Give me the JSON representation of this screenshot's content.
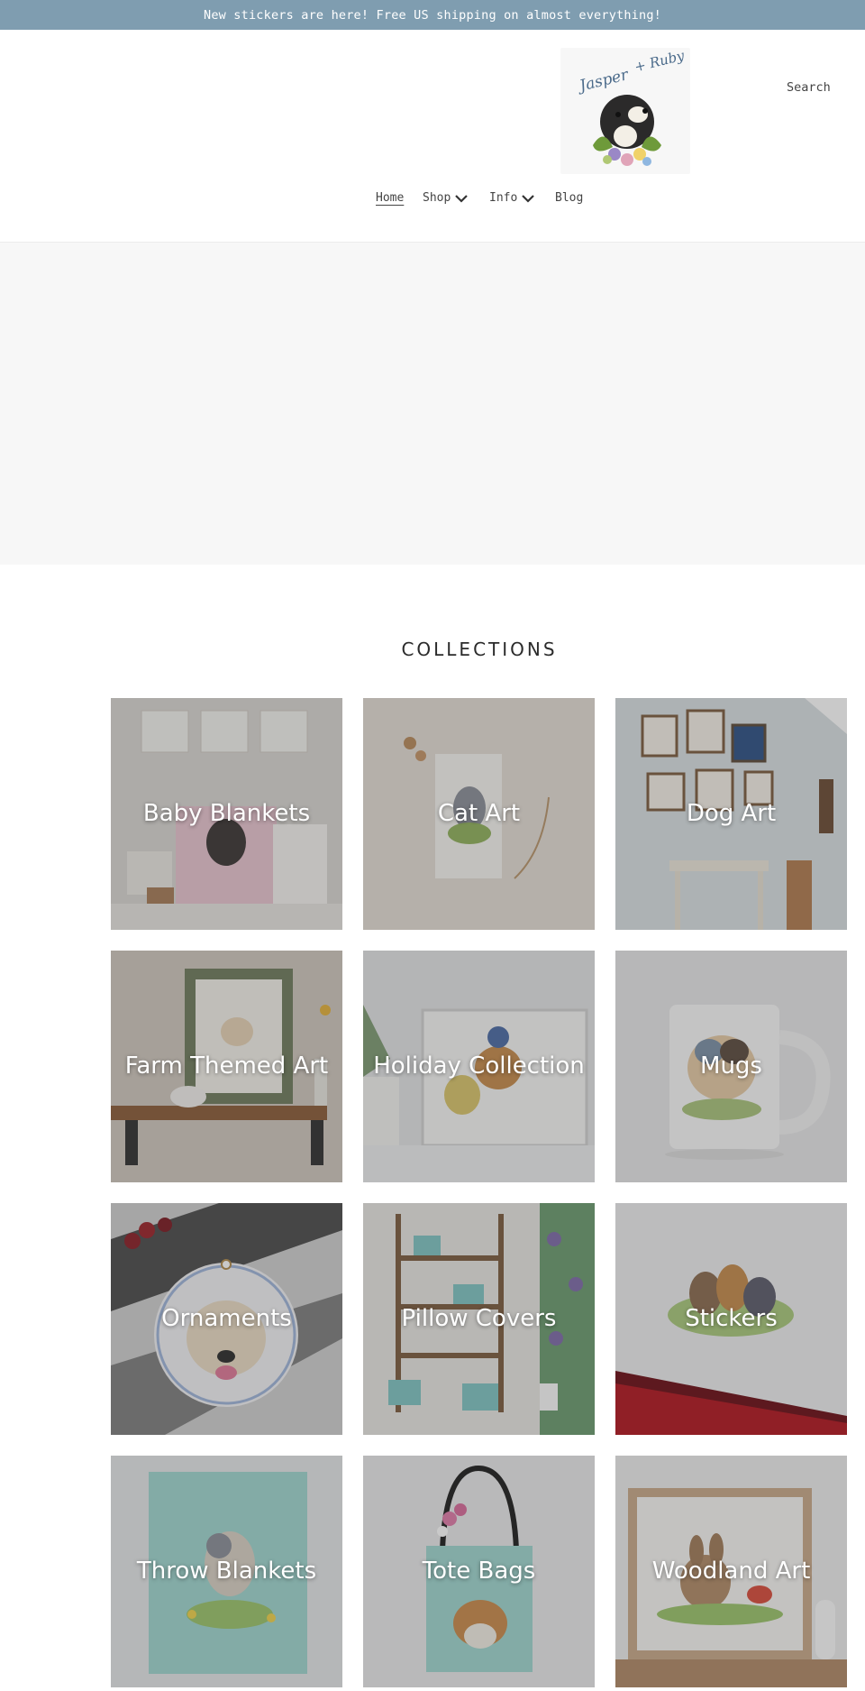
{
  "announcement": "New stickers are here! Free US shipping on almost everything!",
  "header": {
    "logo_text": "Jasper + Ruby",
    "search_label": "Search"
  },
  "nav": {
    "items": [
      {
        "label": "Home",
        "active": true,
        "has_dropdown": false
      },
      {
        "label": "Shop",
        "active": false,
        "has_dropdown": true
      },
      {
        "label": "Info",
        "active": false,
        "has_dropdown": true
      },
      {
        "label": "Blog",
        "active": false,
        "has_dropdown": false
      }
    ]
  },
  "collections": {
    "title": "COLLECTIONS",
    "items": [
      {
        "label": "Baby Blankets"
      },
      {
        "label": "Cat Art"
      },
      {
        "label": "Dog Art"
      },
      {
        "label": "Farm Themed Art"
      },
      {
        "label": "Holiday Collection"
      },
      {
        "label": "Mugs"
      },
      {
        "label": "Ornaments"
      },
      {
        "label": "Pillow Covers"
      },
      {
        "label": "Stickers"
      },
      {
        "label": "Throw Blankets"
      },
      {
        "label": "Tote Bags"
      },
      {
        "label": "Woodland Art"
      }
    ]
  },
  "colors": {
    "announcement_bg": "#7f9db0",
    "hero_bg": "#f7f7f7",
    "tile_overlay": "rgba(60,60,60,0.28)"
  }
}
